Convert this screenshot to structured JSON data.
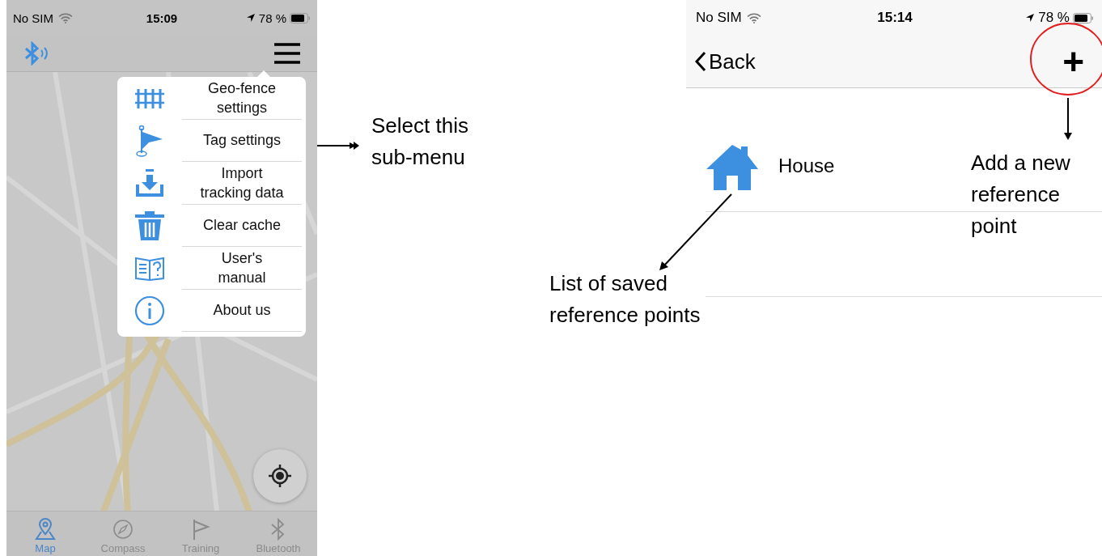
{
  "left_phone": {
    "status_bar": {
      "carrier": "No SIM",
      "time": "15:09",
      "battery": "78 %"
    },
    "menu_items": [
      {
        "kind": "fence",
        "label": "Geo-fence\nsettings"
      },
      {
        "kind": "flag",
        "label": "Tag settings"
      },
      {
        "kind": "import",
        "label": "Import\ntracking data"
      },
      {
        "kind": "trash",
        "label": "Clear cache"
      },
      {
        "kind": "manual",
        "label": "User's\nmanual"
      },
      {
        "kind": "info",
        "label": "About us"
      }
    ],
    "tabs": [
      {
        "kind": "map",
        "label": "Map",
        "selected": true
      },
      {
        "kind": "compass",
        "label": "Compass",
        "selected": false
      },
      {
        "kind": "flag",
        "label": "Training",
        "selected": false
      },
      {
        "kind": "bluetooth",
        "label": "Bluetooth",
        "selected": false
      }
    ]
  },
  "right_phone": {
    "status_bar": {
      "carrier": "No SIM",
      "time": "15:14",
      "battery": "78 %"
    },
    "back": "Back",
    "add": "+",
    "items": [
      {
        "label": "House"
      }
    ]
  },
  "annotations": [
    {
      "kind": "submenu",
      "text": "Select this\nsub-menu"
    },
    {
      "kind": "list",
      "text": "List of saved\nreference points"
    },
    {
      "kind": "add",
      "text": "Add a new\nreference\npoint"
    }
  ]
}
